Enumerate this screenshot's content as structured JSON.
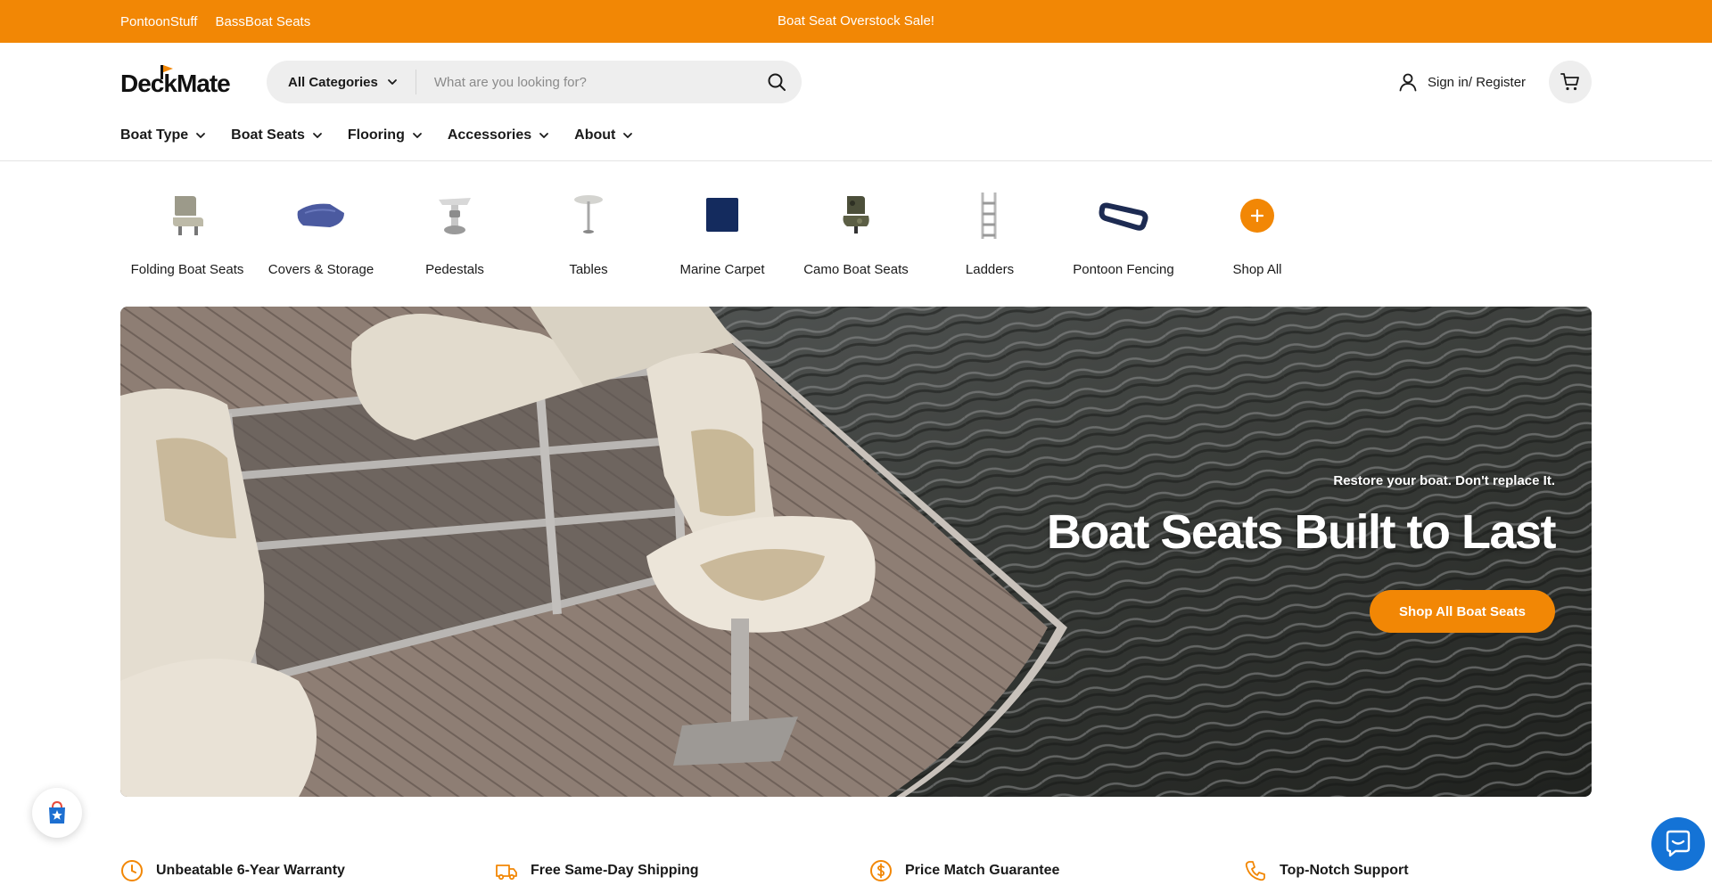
{
  "colors": {
    "accent": "#f28705",
    "chat": "#1473d6",
    "text": "#1a1a1a",
    "search_bg": "#eeeeee"
  },
  "topbar": {
    "links": [
      "PontoonStuff",
      "BassBoat Seats"
    ],
    "promo": "Boat Seat Overstock Sale!"
  },
  "header": {
    "logo": "DeckMate",
    "search": {
      "category": "All Categories",
      "placeholder": "What are you looking for?"
    },
    "account_label": "Sign in/ Register"
  },
  "nav": {
    "items": [
      "Boat Type",
      "Boat Seats",
      "Flooring",
      "Accessories",
      "About"
    ]
  },
  "categories": [
    {
      "label": "Folding Boat Seats",
      "icon": "folding-seat-icon"
    },
    {
      "label": "Covers & Storage",
      "icon": "boat-cover-icon"
    },
    {
      "label": "Pedestals",
      "icon": "pedestal-icon"
    },
    {
      "label": "Tables",
      "icon": "table-icon"
    },
    {
      "label": "Marine Carpet",
      "icon": "carpet-icon"
    },
    {
      "label": "Camo Boat Seats",
      "icon": "camo-seat-icon"
    },
    {
      "label": "Ladders",
      "icon": "ladder-icon"
    },
    {
      "label": "Pontoon Fencing",
      "icon": "fence-icon"
    },
    {
      "label": "Shop All",
      "icon": "plus-icon"
    }
  ],
  "hero": {
    "subtitle": "Restore your boat. Don't replace It.",
    "title": "Boat Seats Built to Last",
    "cta": "Shop All Boat Seats"
  },
  "features": [
    {
      "label": "Unbeatable 6-Year Warranty",
      "icon": "clock-icon"
    },
    {
      "label": "Free Same-Day Shipping",
      "icon": "truck-icon"
    },
    {
      "label": "Price Match Guarantee",
      "icon": "dollar-icon"
    },
    {
      "label": "Top-Notch Support",
      "icon": "phone-icon"
    }
  ]
}
